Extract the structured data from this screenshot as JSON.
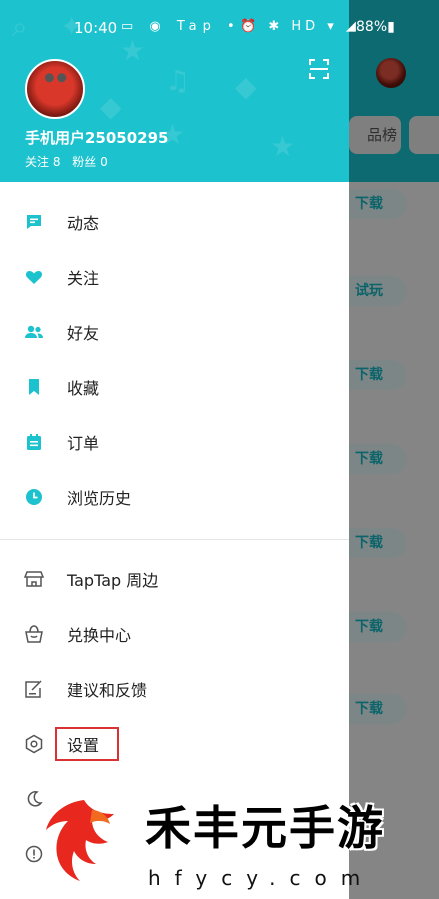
{
  "status_bar": {
    "time": "10:40",
    "left_icons": "▭ ◉ Tap •",
    "right_icons": "⏰ ✱ HD ▾ ◢",
    "battery": "88%▮"
  },
  "background_app": {
    "tab_label": "品榜",
    "pills": [
      "下载",
      "试玩",
      "下载",
      "下载",
      "下载",
      "下载",
      "下载"
    ]
  },
  "drawer": {
    "user": {
      "name": "手机用户25050295",
      "following_label": "关注 8",
      "followers_label": "粉丝 0"
    },
    "primary_menu": [
      {
        "label": "动态",
        "icon": "message-icon"
      },
      {
        "label": "关注",
        "icon": "heart-icon"
      },
      {
        "label": "好友",
        "icon": "friends-icon"
      },
      {
        "label": "收藏",
        "icon": "bookmark-icon"
      },
      {
        "label": "订单",
        "icon": "order-icon"
      },
      {
        "label": "浏览历史",
        "icon": "clock-icon"
      }
    ],
    "secondary_menu": [
      {
        "label": "TapTap 周边",
        "icon": "store-icon"
      },
      {
        "label": "兑换中心",
        "icon": "gift-bag-icon"
      },
      {
        "label": "建议和反馈",
        "icon": "feedback-icon"
      },
      {
        "label": "设置",
        "icon": "settings-icon"
      }
    ]
  },
  "watermark": {
    "title": "禾丰元手游",
    "url": "hfycy.com"
  },
  "colors": {
    "accent": "#1cc2cd",
    "highlight": "#d83232"
  }
}
